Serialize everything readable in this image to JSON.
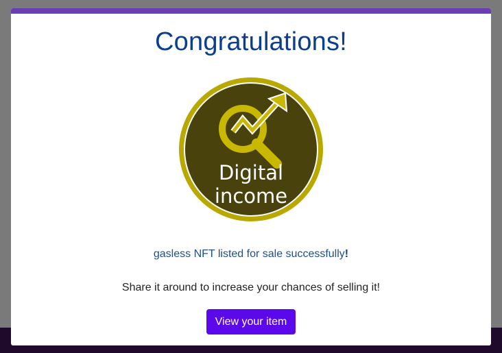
{
  "modal": {
    "title": "Congratulations!",
    "logo": {
      "line1": "Digital",
      "line2": "income",
      "colors": {
        "ring": "#b8a800",
        "fill": "#4a420d",
        "accent": "#c9b800",
        "text": "#ffffff"
      }
    },
    "success_text": "gasless NFT listed for sale successfully",
    "success_excl": "!",
    "share_text": "Share it around to increase your chances of selling it!",
    "view_button_label": "View your item"
  },
  "colors": {
    "accent_bar": "#6b3fb3",
    "title": "#0b3d91",
    "button": "#5b08ea",
    "overlay": "#7a7a7a",
    "bottom_strip": "#1f0a2b"
  }
}
